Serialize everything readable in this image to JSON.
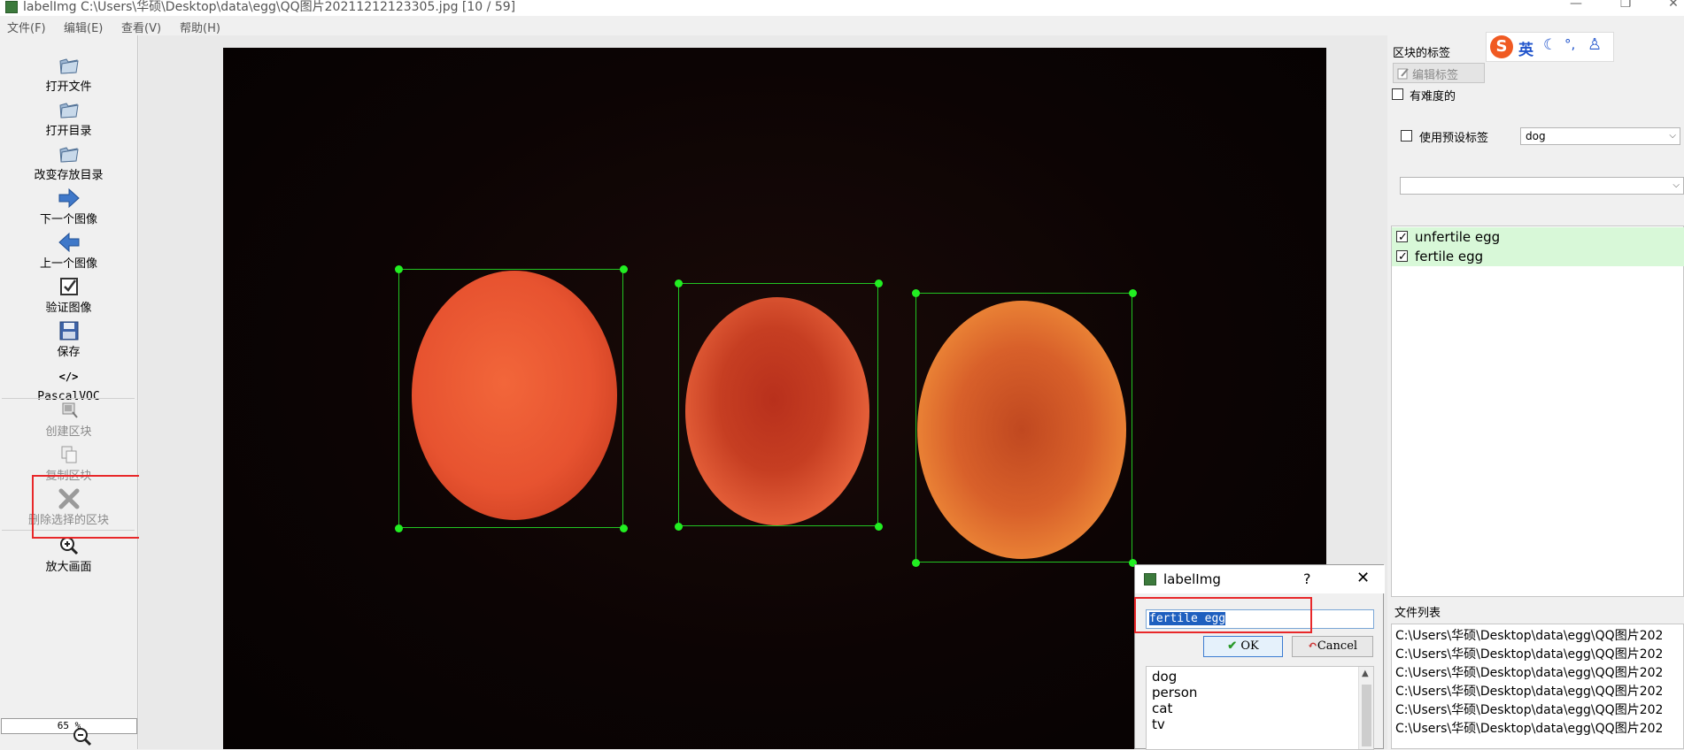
{
  "window": {
    "title": "labelImg C:\\Users\\华硕\\Desktop\\data\\egg\\QQ图片20211212123305.jpg [10 / 59]",
    "minimize_glyph": "—",
    "restore_glyph": "❐",
    "close_glyph": "✕"
  },
  "menu": [
    "文件(F)",
    "编辑(E)",
    "查看(V)",
    "帮助(H)"
  ],
  "toolbar": {
    "open_file": "打开文件",
    "open_dir": "打开目录",
    "change_save_dir": "改变存放目录",
    "next_image": "下一个图像",
    "prev_image": "上一个图像",
    "verify_image": "验证图像",
    "save": "保存",
    "format_icon": "</>",
    "format": "PascalVOC",
    "create_box": "创建区块",
    "duplicate_box": "复制区块",
    "delete_box": "删除选择的区块",
    "zoom_in": "放大画面",
    "zoom_value": "65 %"
  },
  "right_panel": {
    "box_labels_title": "区块的标签",
    "edit_label": "编辑标签",
    "difficult": "有难度的",
    "use_default_label": "使用预设标签",
    "default_label_value": "dog",
    "labels": [
      {
        "text": "unfertile egg",
        "checked": true
      },
      {
        "text": "fertile egg",
        "checked": true
      }
    ],
    "file_list_title": "文件列表",
    "files": [
      "C:\\Users\\华硕\\Desktop\\data\\egg\\QQ图片202",
      "C:\\Users\\华硕\\Desktop\\data\\egg\\QQ图片202",
      "C:\\Users\\华硕\\Desktop\\data\\egg\\QQ图片202",
      "C:\\Users\\华硕\\Desktop\\data\\egg\\QQ图片202",
      "C:\\Users\\华硕\\Desktop\\data\\egg\\QQ图片202",
      "C:\\Users\\华硕\\Desktop\\data\\egg\\QQ图片202"
    ]
  },
  "ime": {
    "logo": "S",
    "mode": "英",
    "moon": "☾",
    "punct": "°,",
    "user": "♙"
  },
  "dialog": {
    "title": "labelImg",
    "help": "?",
    "close": "✕",
    "input_value": "fertile egg",
    "ok": "OK",
    "cancel": "Cancel",
    "suggestions": [
      "dog",
      "person",
      "cat",
      "tv"
    ]
  },
  "colors": {
    "bbox": "#22c422",
    "handle": "#22ee22",
    "highlight": "#e8282a",
    "label_row_bg": "#d8f8d8"
  }
}
